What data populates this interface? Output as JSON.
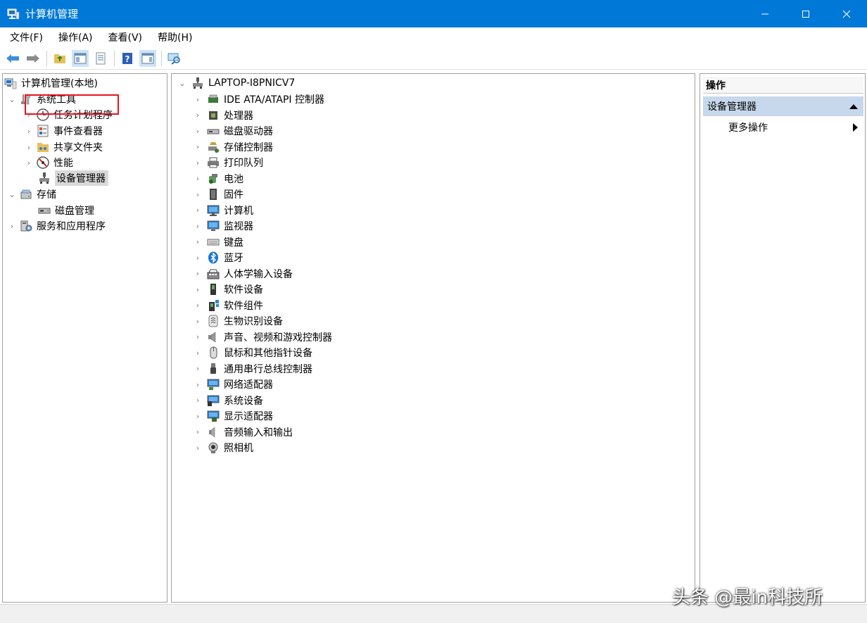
{
  "window": {
    "title": "计算机管理"
  },
  "menu": [
    "文件(F)",
    "操作(A)",
    "查看(V)",
    "帮助(H)"
  ],
  "tree": {
    "root": "计算机管理(本地)",
    "system_tools": "系统工具",
    "task_scheduler": "任务计划程序",
    "event_viewer": "事件查看器",
    "shared_folders": "共享文件夹",
    "performance": "性能",
    "device_manager": "设备管理器",
    "storage": "存储",
    "disk_management": "磁盘管理",
    "services_apps": "服务和应用程序"
  },
  "devices": {
    "computer_name": "LAPTOP-I8PNICV7",
    "categories": [
      {
        "label": "IDE ATA/ATAPI 控制器",
        "icon": "ide-controller-icon"
      },
      {
        "label": "处理器",
        "icon": "processor-icon"
      },
      {
        "label": "磁盘驱动器",
        "icon": "disk-drive-icon"
      },
      {
        "label": "存储控制器",
        "icon": "storage-controller-icon"
      },
      {
        "label": "打印队列",
        "icon": "printer-icon"
      },
      {
        "label": "电池",
        "icon": "battery-icon"
      },
      {
        "label": "固件",
        "icon": "firmware-icon"
      },
      {
        "label": "计算机",
        "icon": "computer-icon"
      },
      {
        "label": "监视器",
        "icon": "monitor-icon"
      },
      {
        "label": "键盘",
        "icon": "keyboard-icon"
      },
      {
        "label": "蓝牙",
        "icon": "bluetooth-icon"
      },
      {
        "label": "人体学输入设备",
        "icon": "hid-icon"
      },
      {
        "label": "软件设备",
        "icon": "software-device-icon"
      },
      {
        "label": "软件组件",
        "icon": "software-component-icon"
      },
      {
        "label": "生物识别设备",
        "icon": "biometric-icon"
      },
      {
        "label": "声音、视频和游戏控制器",
        "icon": "sound-icon"
      },
      {
        "label": "鼠标和其他指针设备",
        "icon": "mouse-icon"
      },
      {
        "label": "通用串行总线控制器",
        "icon": "usb-icon"
      },
      {
        "label": "网络适配器",
        "icon": "network-adapter-icon"
      },
      {
        "label": "系统设备",
        "icon": "system-device-icon"
      },
      {
        "label": "显示适配器",
        "icon": "display-adapter-icon"
      },
      {
        "label": "音频输入和输出",
        "icon": "audio-io-icon"
      },
      {
        "label": "照相机",
        "icon": "camera-icon"
      }
    ]
  },
  "actions": {
    "header": "操作",
    "section": "设备管理器",
    "more": "更多操作"
  },
  "watermark": "头条 @最in科技所",
  "colors": {
    "titlebar": "#0078d7",
    "highlight_box": "#e81123",
    "actions_section": "#c7d8ec"
  }
}
